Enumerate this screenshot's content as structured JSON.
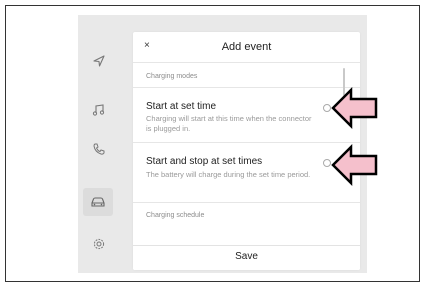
{
  "rail": {
    "items": [
      {
        "icon": "navigation-icon"
      },
      {
        "icon": "music-icon"
      },
      {
        "icon": "phone-icon"
      },
      {
        "icon": "car-icon",
        "active": true
      },
      {
        "icon": "settings-icon"
      }
    ]
  },
  "dialog": {
    "close_glyph": "×",
    "title": "Add event",
    "section_modes": "Charging modes",
    "options": [
      {
        "title": "Start at set time",
        "description": "Charging will start at this time when the connector is plugged in.",
        "selected": false
      },
      {
        "title": "Start and stop at set times",
        "description": "The battery will charge during the set time period.",
        "selected": false
      }
    ],
    "section_schedule": "Charging schedule",
    "save_label": "Save"
  },
  "callouts": [
    {
      "icon": "arrow-left-icon",
      "color": "#f5c0cc",
      "points_to": "radio-start-at-set-time"
    },
    {
      "icon": "arrow-left-icon",
      "color": "#f5c0cc",
      "points_to": "radio-start-and-stop"
    }
  ],
  "colors": {
    "screen_bg": "#e9e9e9",
    "dialog_bg": "#ffffff",
    "callout_fill": "#f5c0cc",
    "callout_stroke": "#000000"
  }
}
